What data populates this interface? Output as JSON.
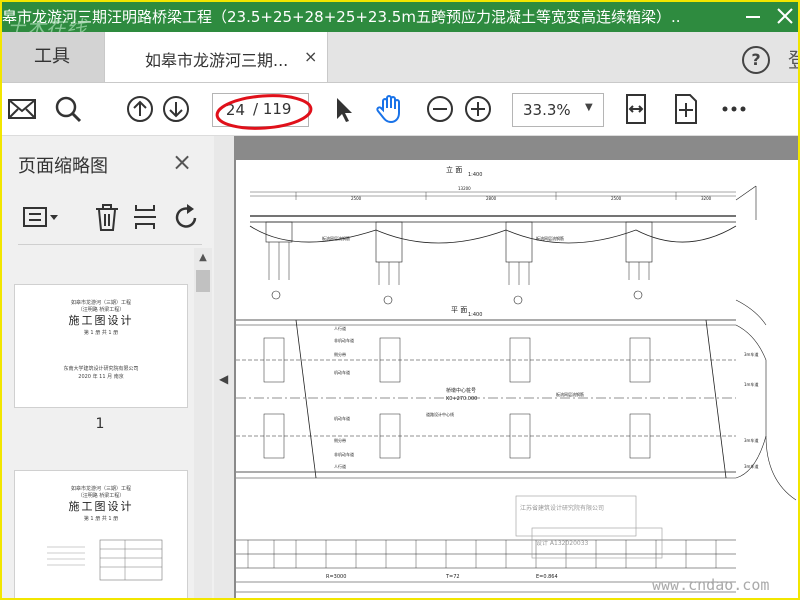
{
  "window": {
    "title": "皋市龙游河三期汪明路桥梁工程（23.5+25+28+25+23.5m五跨预应力混凝土等宽变高连续箱梁）....",
    "logo_text": "土木在线"
  },
  "tabs": {
    "tools_label": "工具",
    "doc_label": "如皋市龙游河三期...",
    "close_glyph": "×",
    "help_glyph": "?",
    "edge_glyph": "登"
  },
  "toolbar": {
    "page_current": "24",
    "page_total": "/ 119",
    "zoom": "33.3%",
    "icons": [
      "mail-icon",
      "search-icon",
      "page-up-icon",
      "page-down-icon",
      "select-arrow-icon",
      "hand-tool-icon",
      "zoom-out-icon",
      "zoom-in-icon",
      "fit-width-icon",
      "fit-page-icon",
      "more-icon"
    ]
  },
  "panel": {
    "title": "页面缩略图",
    "close_glyph": "×",
    "thumbnails": [
      {
        "number": "1",
        "line1": "如皋市龙游河（三期）工程",
        "line2": "（汪明路 桥梁工程）",
        "heading": "施工图设计",
        "sub": "第 1 册  共 1 册",
        "org": "东南大学建筑设计研究院有限公司",
        "date": "2020 年 11 月  南京"
      },
      {
        "number": "",
        "line1": "如皋市龙游河（三期）工程",
        "line2": "（汪明路 桥梁工程）",
        "heading": "施工图设计",
        "sub": "第 1 册  共 1 册"
      }
    ]
  },
  "drawing": {
    "elevation_title": "立  面",
    "elevation_scale": "1:400",
    "plan_title": "平  面",
    "plan_scale": "1:400",
    "spans": [
      "2500",
      "2800",
      "2500",
      "3200"
    ],
    "total": "13200",
    "station": "K0+270.000",
    "center_label": "桥墩中心桩号",
    "road_center": "道路设计中心线",
    "lanes": [
      "人行道",
      "非机动车道",
      "侧分带",
      "机动车道",
      "机动车道",
      "侧分带",
      "非机动车道",
      "人行道"
    ],
    "callouts": [
      "板流网层流钢筋",
      "板流网层流钢筋",
      "板流网层流钢筋"
    ],
    "right_labels": [
      "3m车道",
      "1m车道",
      "3m车道",
      "3m车道"
    ],
    "bottom_values": [
      "R=3000",
      "T=72",
      "E=0.864"
    ],
    "stamp": "江苏省建筑设计研究院有限公司",
    "stamp2": "设计 A132020033",
    "site_watermark": "www.cndao.com"
  }
}
